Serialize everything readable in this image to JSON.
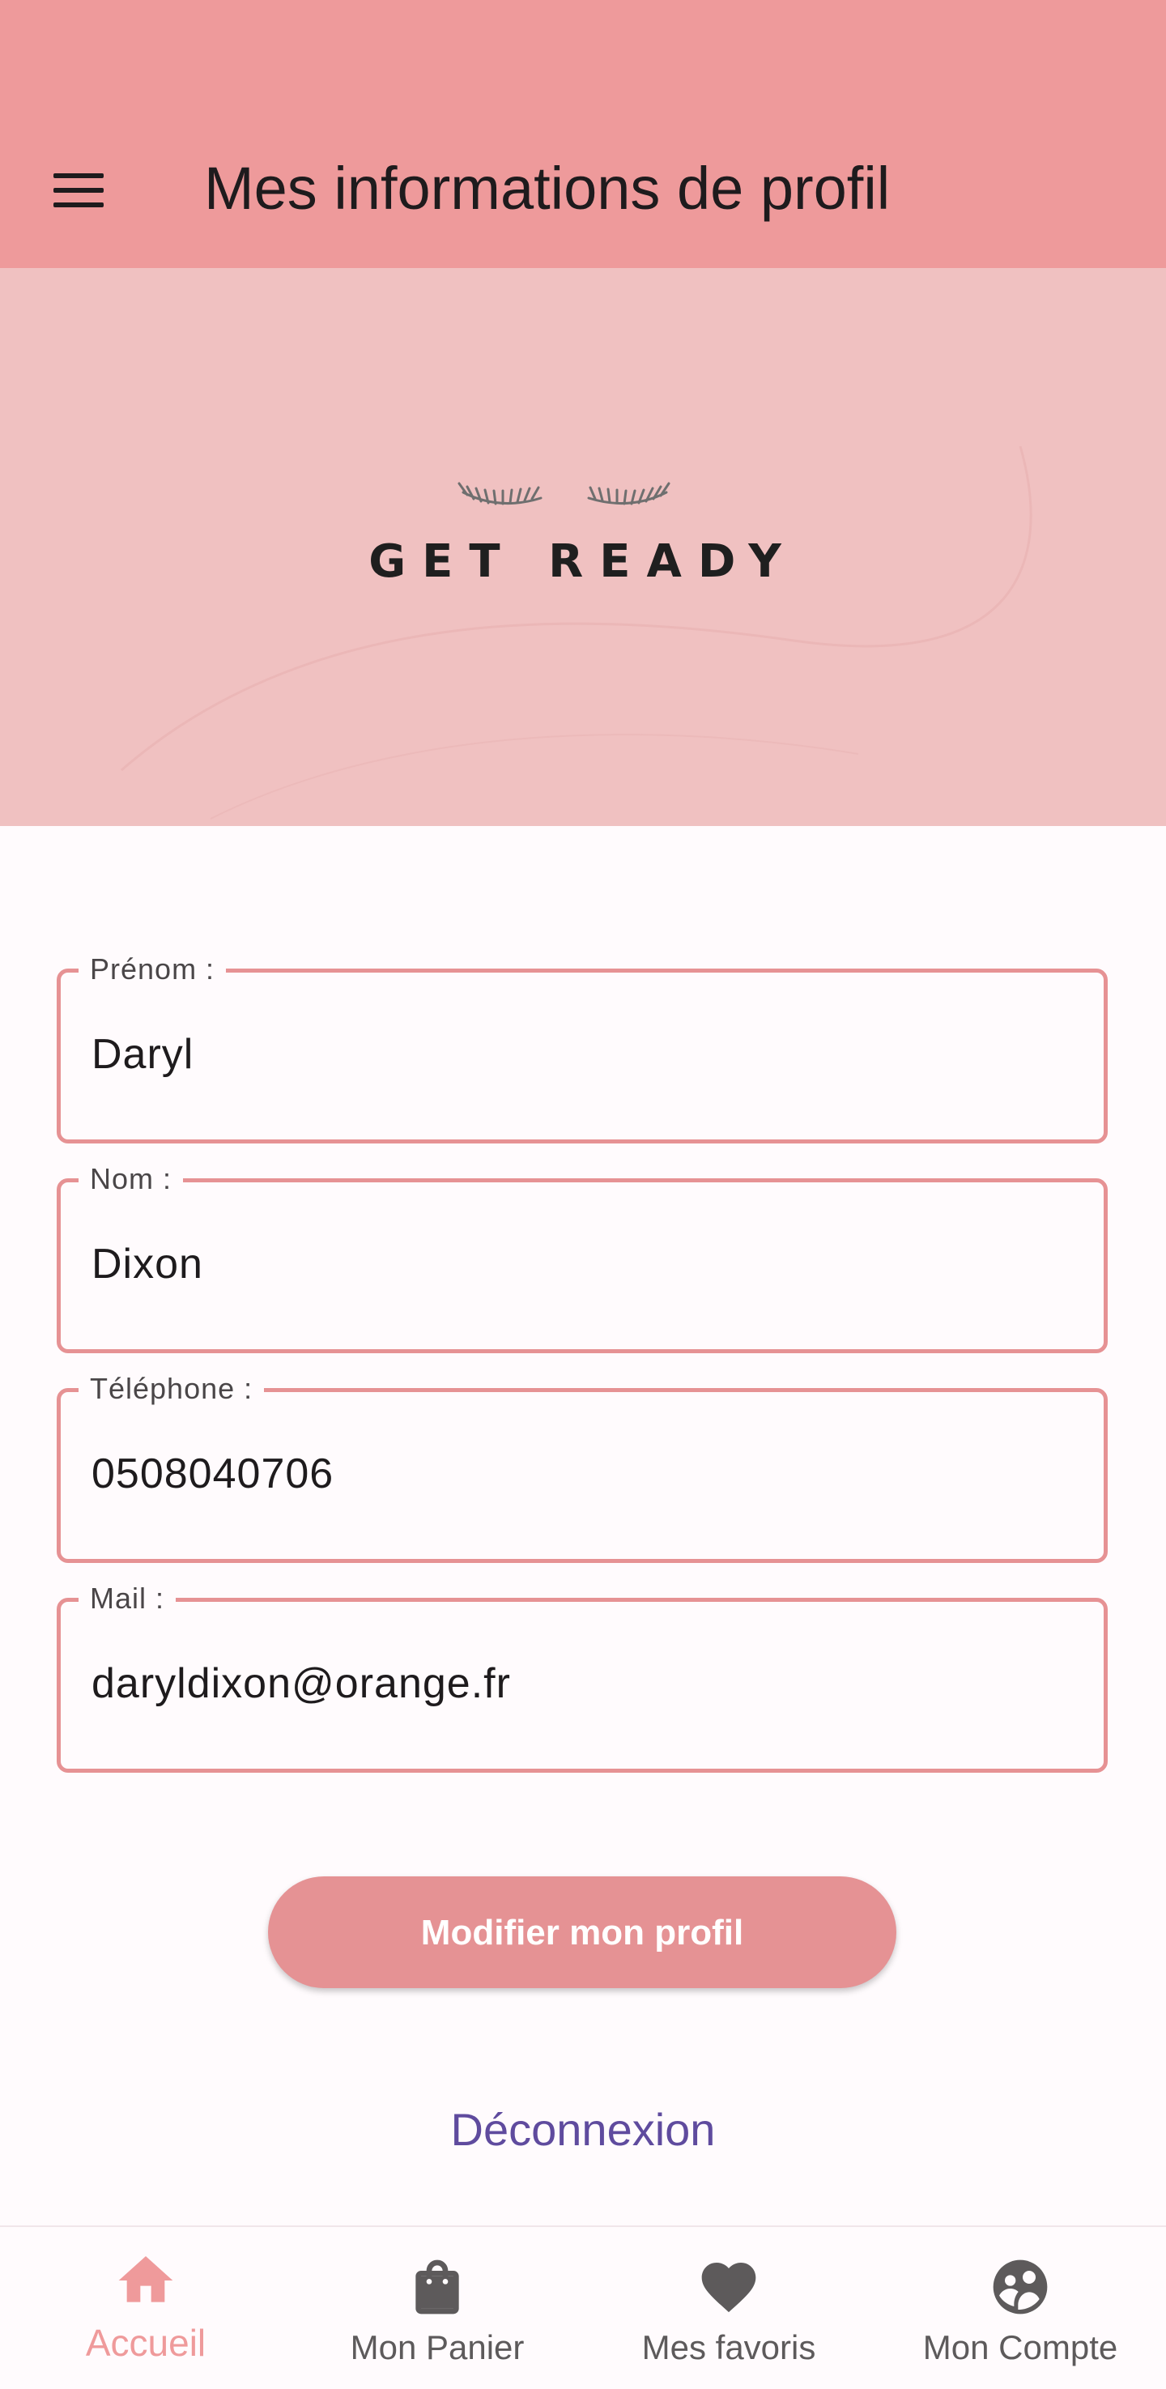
{
  "appbar": {
    "title": "Mes informations de profil",
    "menu_icon": "menu-icon",
    "color": "#ee9a9b"
  },
  "banner": {
    "logo_text": "GET READY",
    "background": "#f0c1c1"
  },
  "form": {
    "fields": [
      {
        "label": "Prénom :",
        "value": "Daryl"
      },
      {
        "label": "Nom :",
        "value": "Dixon"
      },
      {
        "label": "Téléphone :",
        "value": "0508040706"
      },
      {
        "label": "Mail :",
        "value": "daryldixon@orange.fr"
      }
    ],
    "border_color": "#e69294"
  },
  "actions": {
    "submit_label": "Modifier mon profil",
    "logout_label": "Déconnexion",
    "logout_color": "#5f4b9e"
  },
  "bottom_nav": {
    "items": [
      {
        "label": "Accueil",
        "icon": "home-icon",
        "active": true
      },
      {
        "label": "Mon Panier",
        "icon": "shopping-bag-icon",
        "active": false
      },
      {
        "label": "Mes favoris",
        "icon": "heart-icon",
        "active": false
      },
      {
        "label": "Mon Compte",
        "icon": "account-group-icon",
        "active": false
      }
    ],
    "active_color": "#ef9a9b",
    "inactive_color": "#5d5a5b"
  }
}
